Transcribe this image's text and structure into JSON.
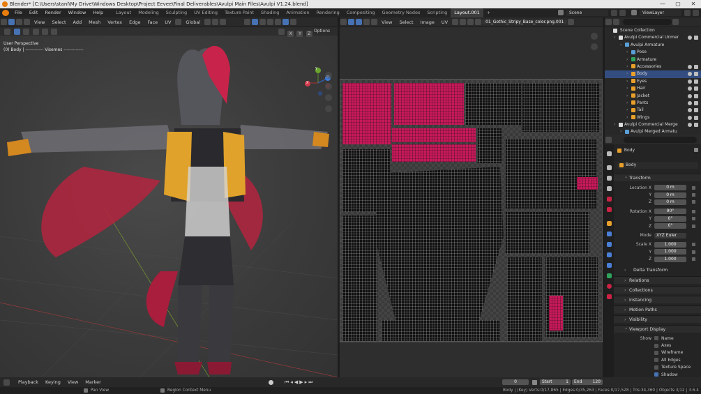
{
  "titlebar": {
    "title": "Blender* [C:\\Users\\stanl\\My Drive\\Windows Desktop\\Project Eevee\\Final Deliverables\\Avulpi Main Files\\Avulpi V1.24.blend]",
    "minimize": "—",
    "maximize": "▢",
    "close": "✕"
  },
  "menubar": {
    "items": [
      "File",
      "Edit",
      "Render",
      "Window",
      "Help"
    ]
  },
  "workspaces": [
    "Layout",
    "Modeling",
    "Sculpting",
    "UV Editing",
    "Texture Paint",
    "Shading",
    "Animation",
    "Rendering",
    "Compositing",
    "Geometry Nodes",
    "Scripting",
    "Layout.001",
    "+"
  ],
  "active_workspace": "Layout.001",
  "scene": {
    "label": "Scene",
    "view_layer": "ViewLayer"
  },
  "viewport3d": {
    "header_items": [
      "View",
      "Select",
      "Add",
      "Mesh",
      "Vertex",
      "Edge",
      "Face",
      "UV"
    ],
    "orientation": "Global",
    "options": "Options",
    "axes_toggle": [
      "X",
      "Y",
      "Z"
    ],
    "view_name": "User Perspective",
    "object_info": "(0) Body | ------------ Visemes -------------",
    "gizmo_labels": [
      "X",
      "Y",
      "Z"
    ]
  },
  "uv_editor": {
    "header_items": [
      "View",
      "Select",
      "Image",
      "UV"
    ],
    "image_name": "01_Gothic_Stripy_Base_color.png.001"
  },
  "outliner": {
    "collection": "Scene Collection",
    "rows": [
      {
        "label": "Avulpi Commercial Unmer",
        "indent": 1,
        "selected": false
      },
      {
        "label": "Avulpi Armature",
        "indent": 2,
        "selected": false
      },
      {
        "label": "Pose",
        "indent": 3,
        "selected": false
      },
      {
        "label": "Armature",
        "indent": 3,
        "selected": false
      },
      {
        "label": "Accessories",
        "indent": 3,
        "selected": false
      },
      {
        "label": "Body",
        "indent": 3,
        "selected": true
      },
      {
        "label": "Eyes",
        "indent": 3,
        "selected": false
      },
      {
        "label": "Hair",
        "indent": 3,
        "selected": false
      },
      {
        "label": "Jacket",
        "indent": 3,
        "selected": false
      },
      {
        "label": "Pants",
        "indent": 3,
        "selected": false
      },
      {
        "label": "Tail",
        "indent": 3,
        "selected": false
      },
      {
        "label": "Wings",
        "indent": 3,
        "selected": false
      },
      {
        "label": "Avulpi Commercial Merge",
        "indent": 1,
        "selected": false
      },
      {
        "label": "Avulpi Merged Armatu",
        "indent": 2,
        "selected": false
      }
    ]
  },
  "properties": {
    "search_placeholder": "",
    "object_name": "Body",
    "object_field": "Body",
    "transform": {
      "title": "Transform",
      "location": {
        "label": "Location X",
        "x": "0 m",
        "y": "0 m",
        "z": "0 m"
      },
      "rotation": {
        "label": "Rotation X",
        "x": "90°",
        "y": "0°",
        "z": "0°"
      },
      "mode": {
        "label": "Mode",
        "value": "XYZ Euler"
      },
      "scale": {
        "label": "Scale X",
        "x": "1.000",
        "y": "1.000",
        "z": "1.000"
      },
      "axis_labels": [
        "Y",
        "Z"
      ]
    },
    "sections": [
      "Delta Transform",
      "Relations",
      "Collections",
      "Instancing",
      "Motion Paths",
      "Visibility",
      "Viewport Display"
    ],
    "viewport_display": {
      "show_label": "Show",
      "options": [
        {
          "label": "Name",
          "checked": false
        },
        {
          "label": "Axes",
          "checked": false
        },
        {
          "label": "Wireframe",
          "checked": false
        },
        {
          "label": "All Edges",
          "checked": false
        },
        {
          "label": "Texture Space",
          "checked": false
        },
        {
          "label": "Shadow",
          "checked": true
        }
      ]
    }
  },
  "timeline": {
    "menus": [
      "Playback",
      "Keying",
      "View",
      "Marker"
    ],
    "current_frame": "0",
    "start_label": "Start",
    "start": "1",
    "end_label": "End",
    "end": "120"
  },
  "statusbar": {
    "left": "Pan View",
    "middle": "Region Context Menu",
    "stats": "Body | (Key) Verts:0/17,865 | Edges:0/35,263 | Faces:0/17,528 | Tris:34,360 | Objects:3/12 | 3.6.4"
  },
  "colors": {
    "accent": "#4772b3",
    "selection": "#334d80",
    "orange": "#e87d0d"
  }
}
